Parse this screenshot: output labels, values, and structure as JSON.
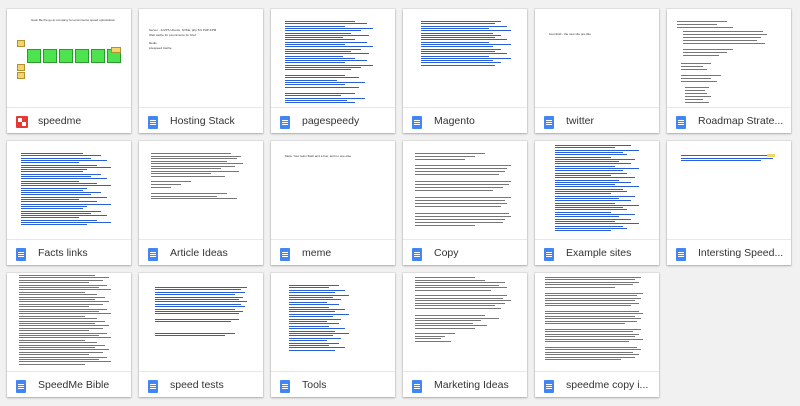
{
  "files": [
    {
      "title": "speedme",
      "icon": "speedme-slides-icon"
    },
    {
      "title": "Hosting Stack",
      "icon": "google-docs-icon"
    },
    {
      "title": "pagespeedy",
      "icon": "google-docs-icon"
    },
    {
      "title": "Magento",
      "icon": "google-docs-icon"
    },
    {
      "title": "twitter",
      "icon": "google-docs-icon"
    },
    {
      "title": "Roadmap Strate...",
      "icon": "google-docs-icon"
    },
    {
      "title": "Facts links",
      "icon": "google-docs-icon"
    },
    {
      "title": "Article Ideas",
      "icon": "google-docs-icon"
    },
    {
      "title": "meme",
      "icon": "google-docs-icon"
    },
    {
      "title": "Copy",
      "icon": "google-docs-icon"
    },
    {
      "title": "Example sites",
      "icon": "google-docs-icon"
    },
    {
      "title": "Intersting Speed...",
      "icon": "google-docs-icon"
    },
    {
      "title": "SpeedMe Bible",
      "icon": "google-docs-icon"
    },
    {
      "title": "speed tests",
      "icon": "google-docs-icon"
    },
    {
      "title": "Tools",
      "icon": "google-docs-icon"
    },
    {
      "title": "Marketing Ideas",
      "icon": "google-docs-icon"
    },
    {
      "title": "speedme copy i...",
      "icon": "google-docs-icon"
    }
  ],
  "colors": {
    "doc_blue": "#4285f4",
    "speedme_red": "#e53935",
    "link_blue": "#2b5fd9",
    "text_gray": "#777777",
    "box_green": "#4ee34e",
    "box_yellow": "#f4d46a"
  },
  "previews": {
    "speedme_heading": "Goal: Be the go-to company for ecommerce speed optimization",
    "hosting_lines": [
      "Server - 4xVPS Ubuntu, NVMe, php 8.0 PHP-FPM",
      "Web cache for ecommerce for brief",
      "Redis",
      "Litespeed Cache"
    ],
    "twitter_line": "boomfold - the new site pre-title",
    "meme_line": "Meta: Your team flash and a bus, and no one else"
  }
}
